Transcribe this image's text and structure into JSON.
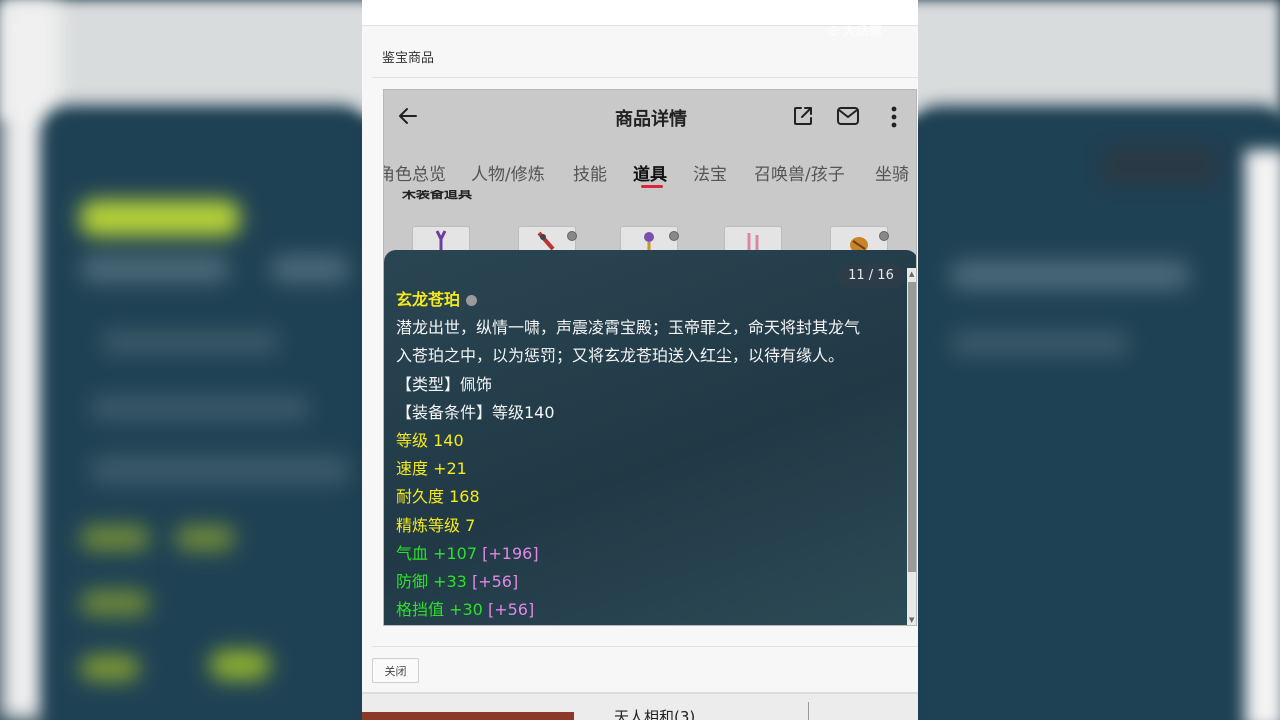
{
  "watermark": "⊙ 大話館",
  "panel": {
    "title": "鉴宝商品",
    "close_label": "关闭",
    "bottom_partial_text": "天人相和(3)"
  },
  "app": {
    "header_title": "商品详情",
    "tabs": [
      {
        "label": "角色总览",
        "active": false
      },
      {
        "label": "人物/修炼",
        "active": false
      },
      {
        "label": "技能",
        "active": false
      },
      {
        "label": "道具",
        "active": true
      },
      {
        "label": "法宝",
        "active": false
      },
      {
        "label": "召唤兽/孩子",
        "active": false
      },
      {
        "label": "坐骑",
        "active": false
      }
    ],
    "section_label": "未装备道具"
  },
  "tooltip": {
    "page_indicator": "11 / 16",
    "item_name": "玄龙苍珀",
    "desc_line1": "潜龙出世，纵情一啸，声震凌霄宝殿；玉帝罪之，命天将封其龙气",
    "desc_line2": "入苍珀之中，以为惩罚；又将玄龙苍珀送入红尘，以待有缘人。",
    "type": "【类型】佩饰",
    "requirement": "【装备条件】等级140",
    "level": "等级 140",
    "speed": "速度 +21",
    "durability": "耐久度 168",
    "refine": "精炼等级 7",
    "hp": "气血 +107",
    "hp_bonus": "[+196]",
    "defense": "防御 +33",
    "defense_bonus": "[+56]",
    "block": "格挡值 +30",
    "block_bonus": "[+56]"
  },
  "colors": {
    "name": "#f4ea1b",
    "base_stats": "#f4ea1b",
    "extra_stats": "#2de02a",
    "bonus": "#e387e6",
    "active_tab_underline": "#d9283a"
  }
}
